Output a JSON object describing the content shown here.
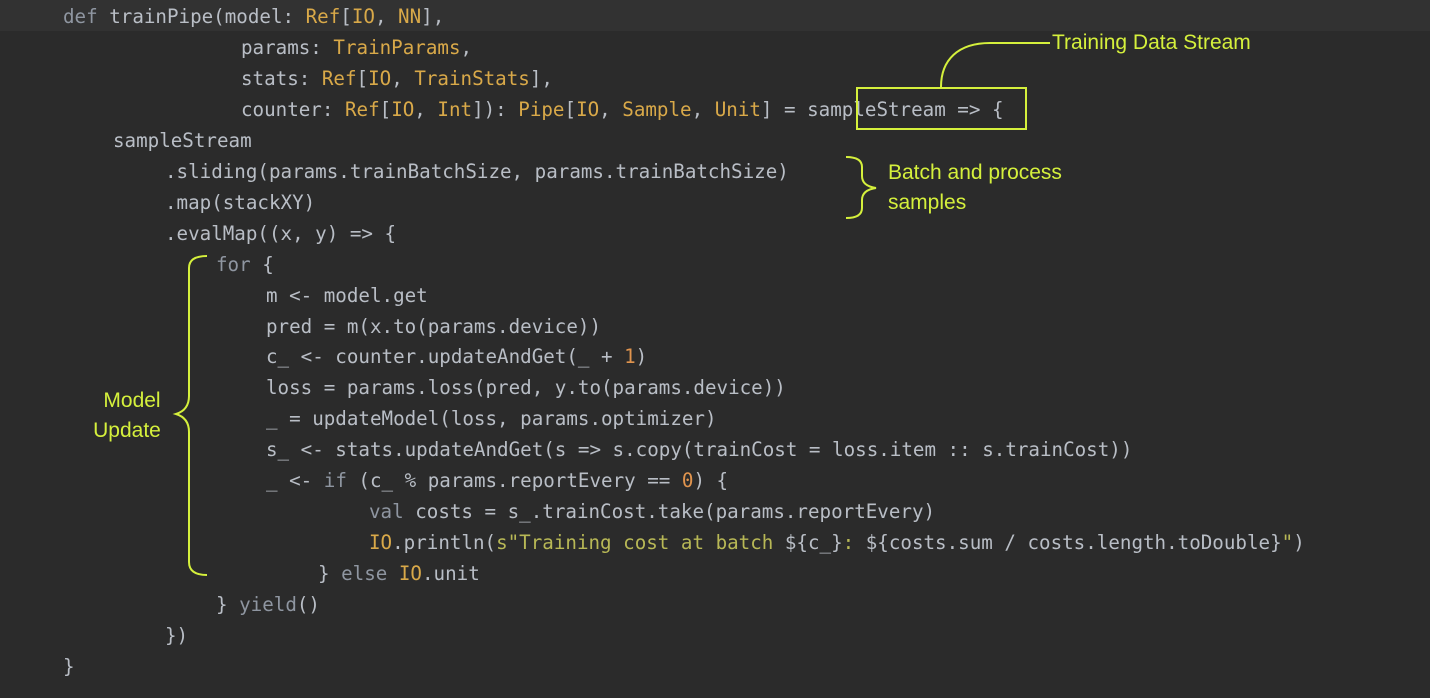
{
  "code": {
    "lines": [
      [
        {
          "t": "def ",
          "c": "kw2"
        },
        {
          "t": "trainPipe(model: ",
          "c": "plain"
        },
        {
          "t": "Ref",
          "c": "type"
        },
        {
          "t": "[",
          "c": "plain"
        },
        {
          "t": "IO",
          "c": "type"
        },
        {
          "t": ", ",
          "c": "plain"
        },
        {
          "t": "NN",
          "c": "type"
        },
        {
          "t": "],",
          "c": "plain"
        }
      ],
      [
        {
          "t": "params: ",
          "c": "plain"
        },
        {
          "t": "TrainParams",
          "c": "type"
        },
        {
          "t": ",",
          "c": "plain"
        }
      ],
      [
        {
          "t": "stats: ",
          "c": "plain"
        },
        {
          "t": "Ref",
          "c": "type"
        },
        {
          "t": "[",
          "c": "plain"
        },
        {
          "t": "IO",
          "c": "type"
        },
        {
          "t": ", ",
          "c": "plain"
        },
        {
          "t": "TrainStats",
          "c": "type"
        },
        {
          "t": "],",
          "c": "plain"
        }
      ],
      [
        {
          "t": "counter: ",
          "c": "plain"
        },
        {
          "t": "Ref",
          "c": "type"
        },
        {
          "t": "[",
          "c": "plain"
        },
        {
          "t": "IO",
          "c": "type"
        },
        {
          "t": ", ",
          "c": "plain"
        },
        {
          "t": "Int",
          "c": "type"
        },
        {
          "t": "]): ",
          "c": "plain"
        },
        {
          "t": "Pipe",
          "c": "type"
        },
        {
          "t": "[",
          "c": "plain"
        },
        {
          "t": "IO",
          "c": "type"
        },
        {
          "t": ", ",
          "c": "plain"
        },
        {
          "t": "Sample",
          "c": "type"
        },
        {
          "t": ", ",
          "c": "plain"
        },
        {
          "t": "Unit",
          "c": "type"
        },
        {
          "t": "] = sampleStream => {",
          "c": "plain"
        }
      ],
      [
        {
          "t": "sampleStream",
          "c": "plain"
        }
      ],
      [
        {
          "t": ".sliding(params.trainBatchSize, params.trainBatchSize)",
          "c": "plain"
        }
      ],
      [
        {
          "t": ".map(stackXY)",
          "c": "plain"
        }
      ],
      [
        {
          "t": ".evalMap((x, y) => {",
          "c": "plain"
        }
      ],
      [
        {
          "t": "for ",
          "c": "kw2"
        },
        {
          "t": "{",
          "c": "plain"
        }
      ],
      [
        {
          "t": "m <- model.get",
          "c": "plain"
        }
      ],
      [
        {
          "t": "pred = m(x.to(params.device))",
          "c": "plain"
        }
      ],
      [
        {
          "t": "c_ <- counter.updateAndGet(_ + ",
          "c": "plain"
        },
        {
          "t": "1",
          "c": "num"
        },
        {
          "t": ")",
          "c": "plain"
        }
      ],
      [
        {
          "t": "loss = params.loss(pred, y.to(params.device))",
          "c": "plain"
        }
      ],
      [
        {
          "t": "_ = updateModel(loss, params.optimizer)",
          "c": "plain"
        }
      ],
      [
        {
          "t": "s_ <- stats.updateAndGet(s => s.copy(trainCost = loss.item :: s.trainCost))",
          "c": "plain"
        }
      ],
      [
        {
          "t": "_ <- ",
          "c": "plain"
        },
        {
          "t": "if ",
          "c": "kw2"
        },
        {
          "t": "(c_ % params.reportEvery == ",
          "c": "plain"
        },
        {
          "t": "0",
          "c": "num"
        },
        {
          "t": ") {",
          "c": "plain"
        }
      ],
      [
        {
          "t": "val ",
          "c": "kw2"
        },
        {
          "t": "costs = s_.trainCost.take(params.reportEvery)",
          "c": "plain"
        }
      ],
      [
        {
          "t": "IO",
          "c": "type"
        },
        {
          "t": ".println(",
          "c": "plain"
        },
        {
          "t": "s\"Training cost at batch ",
          "c": "str"
        },
        {
          "t": "${c_}",
          "c": "interp"
        },
        {
          "t": ": ",
          "c": "str"
        },
        {
          "t": "${costs.sum / costs.length.toDouble}",
          "c": "interp"
        },
        {
          "t": "\"",
          "c": "str"
        },
        {
          "t": ")",
          "c": "plain"
        }
      ],
      [
        {
          "t": "} ",
          "c": "plain"
        },
        {
          "t": "else ",
          "c": "kw2"
        },
        {
          "t": "IO",
          "c": "type"
        },
        {
          "t": ".unit",
          "c": "plain"
        }
      ],
      [
        {
          "t": "} ",
          "c": "plain"
        },
        {
          "t": "yield",
          "c": "kw2"
        },
        {
          "t": "()",
          "c": "plain"
        }
      ],
      [
        {
          "t": "})",
          "c": "plain"
        }
      ],
      [
        {
          "t": "}",
          "c": "plain"
        }
      ]
    ]
  },
  "annotations": {
    "training_stream_label": "Training Data Stream",
    "batch_label_line1": "Batch and process",
    "batch_label_line2": "samples",
    "model_update_line1": "Model",
    "model_update_line2": "Update",
    "accent_color": "#d5f03c"
  },
  "colors": {
    "background": "#2b2b2b",
    "keyword": "#8f96a1",
    "type": "#d9a949",
    "plain": "#b9bec6",
    "number": "#e0944e",
    "string": "#b8b856"
  }
}
